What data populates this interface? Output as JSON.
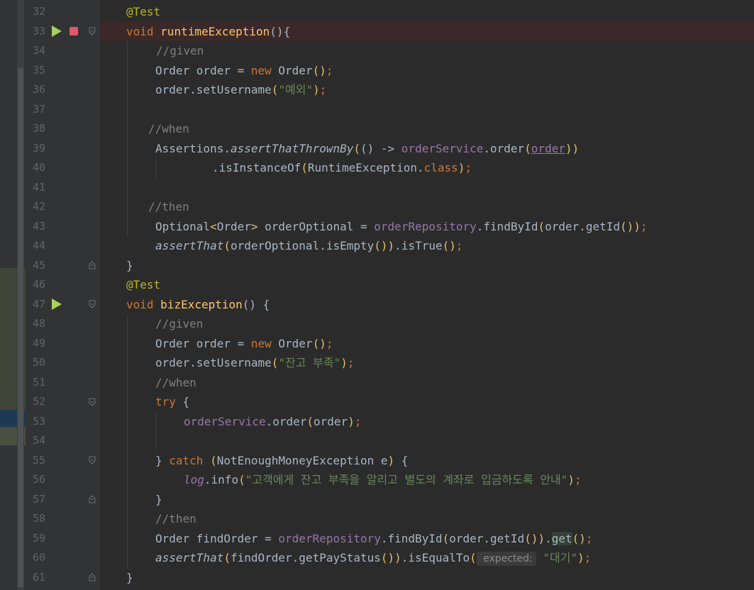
{
  "editor": {
    "lines": [
      {
        "n": "32",
        "tokens": [
          {
            "t": "@Test",
            "c": "an"
          }
        ]
      },
      {
        "n": "33",
        "tokens": [
          {
            "t": "void ",
            "c": "k"
          },
          {
            "t": "runtimeException",
            "c": "fn"
          },
          {
            "t": "(){",
            "c": ""
          }
        ]
      },
      {
        "n": "34",
        "tokens": [
          {
            "t": "//given",
            "c": "cm"
          }
        ]
      },
      {
        "n": "35",
        "tokens": [
          {
            "t": "Order order = ",
            "c": ""
          },
          {
            "t": "new ",
            "c": "k"
          },
          {
            "t": "Order",
            "c": ""
          },
          {
            "t": "()",
            "c": "brk"
          },
          {
            "t": ";",
            "c": "k"
          }
        ]
      },
      {
        "n": "36",
        "tokens": [
          {
            "t": "order.setUsername",
            "c": ""
          },
          {
            "t": "(",
            "c": "brk"
          },
          {
            "t": "\"예외\"",
            "c": "st"
          },
          {
            "t": ")",
            "c": "brk"
          },
          {
            "t": ";",
            "c": "k"
          }
        ]
      },
      {
        "n": "37",
        "tokens": []
      },
      {
        "n": "38",
        "tokens": [
          {
            "t": "//when",
            "c": "cm"
          }
        ]
      },
      {
        "n": "39",
        "tokens": [
          {
            "t": "Assertions.",
            "c": ""
          },
          {
            "t": "assertThatThrownBy",
            "c": "it"
          },
          {
            "t": "(",
            "c": "brk"
          },
          {
            "t": "() -> ",
            "c": ""
          },
          {
            "t": "orderService",
            "c": "fld"
          },
          {
            "t": ".order",
            "c": ""
          },
          {
            "t": "(",
            "c": "brk"
          },
          {
            "t": "order",
            "c": "fld ul"
          },
          {
            "t": "))",
            "c": "brk"
          }
        ]
      },
      {
        "n": "40",
        "tokens": [
          {
            "t": ".isInstanceOf",
            "c": ""
          },
          {
            "t": "(",
            "c": "brk"
          },
          {
            "t": "RuntimeException.",
            "c": ""
          },
          {
            "t": "class",
            "c": "k"
          },
          {
            "t": ")",
            "c": "brk"
          },
          {
            "t": ";",
            "c": "k"
          }
        ]
      },
      {
        "n": "41",
        "tokens": []
      },
      {
        "n": "42",
        "tokens": [
          {
            "t": "//then",
            "c": "cm"
          }
        ]
      },
      {
        "n": "43",
        "tokens": [
          {
            "t": "Optional",
            "c": ""
          },
          {
            "t": "<",
            "c": "brk"
          },
          {
            "t": "Order",
            "c": ""
          },
          {
            "t": ">",
            "c": "brk"
          },
          {
            "t": " orderOptional = ",
            "c": ""
          },
          {
            "t": "orderRepository",
            "c": "fld"
          },
          {
            "t": ".findById",
            "c": ""
          },
          {
            "t": "(",
            "c": "brk"
          },
          {
            "t": "order.getId",
            "c": ""
          },
          {
            "t": "()",
            "c": "brk"
          },
          {
            "t": ")",
            "c": "brk"
          },
          {
            "t": ";",
            "c": "k"
          }
        ]
      },
      {
        "n": "44",
        "tokens": [
          {
            "t": "assertThat",
            "c": "it"
          },
          {
            "t": "(",
            "c": "brk"
          },
          {
            "t": "orderOptional.isEmpty",
            "c": ""
          },
          {
            "t": "()",
            "c": "brk"
          },
          {
            "t": ")",
            "c": "brk"
          },
          {
            "t": ".isTrue",
            "c": ""
          },
          {
            "t": "()",
            "c": "brk"
          },
          {
            "t": ";",
            "c": "k"
          }
        ]
      },
      {
        "n": "45",
        "tokens": [
          {
            "t": "}",
            "c": ""
          }
        ]
      },
      {
        "n": "46",
        "tokens": [
          {
            "t": "@Test",
            "c": "an"
          }
        ]
      },
      {
        "n": "47",
        "tokens": [
          {
            "t": "void ",
            "c": "k"
          },
          {
            "t": "bizException",
            "c": "fn"
          },
          {
            "t": "() {",
            "c": ""
          }
        ]
      },
      {
        "n": "48",
        "tokens": [
          {
            "t": "//given",
            "c": "cm"
          }
        ]
      },
      {
        "n": "49",
        "tokens": [
          {
            "t": "Order order = ",
            "c": ""
          },
          {
            "t": "new ",
            "c": "k"
          },
          {
            "t": "Order",
            "c": ""
          },
          {
            "t": "()",
            "c": "brk"
          },
          {
            "t": ";",
            "c": "k"
          }
        ]
      },
      {
        "n": "50",
        "tokens": [
          {
            "t": "order.setUsername",
            "c": ""
          },
          {
            "t": "(",
            "c": "brk"
          },
          {
            "t": "\"잔고 부족\"",
            "c": "st"
          },
          {
            "t": ")",
            "c": "brk"
          },
          {
            "t": ";",
            "c": "k"
          }
        ]
      },
      {
        "n": "51",
        "tokens": [
          {
            "t": "//when",
            "c": "cm"
          }
        ]
      },
      {
        "n": "52",
        "tokens": [
          {
            "t": "try ",
            "c": "k"
          },
          {
            "t": "{",
            "c": ""
          }
        ]
      },
      {
        "n": "53",
        "tokens": [
          {
            "t": "orderService",
            "c": "fld"
          },
          {
            "t": ".order",
            "c": ""
          },
          {
            "t": "(",
            "c": "brk"
          },
          {
            "t": "order",
            "c": ""
          },
          {
            "t": ")",
            "c": "brk"
          },
          {
            "t": ";",
            "c": "k"
          }
        ]
      },
      {
        "n": "54",
        "tokens": []
      },
      {
        "n": "55",
        "tokens": [
          {
            "t": "} ",
            "c": ""
          },
          {
            "t": "catch ",
            "c": "k"
          },
          {
            "t": "(",
            "c": "brk"
          },
          {
            "t": "NotEnoughMoneyException e",
            "c": ""
          },
          {
            "t": ")",
            "c": "brk"
          },
          {
            "t": " {",
            "c": ""
          }
        ]
      },
      {
        "n": "56",
        "tokens": [
          {
            "t": "log",
            "c": "fld it"
          },
          {
            "t": ".info",
            "c": ""
          },
          {
            "t": "(",
            "c": "brk"
          },
          {
            "t": "\"고객에게 잔고 부족을 알리고 별도의 계좌로 입금하도록 안내\"",
            "c": "st"
          },
          {
            "t": ")",
            "c": "brk"
          },
          {
            "t": ";",
            "c": "k"
          }
        ]
      },
      {
        "n": "57",
        "tokens": [
          {
            "t": "}",
            "c": ""
          }
        ]
      },
      {
        "n": "58",
        "tokens": [
          {
            "t": "//then",
            "c": "cm"
          }
        ]
      },
      {
        "n": "59",
        "tokens": [
          {
            "t": "Order findOrder = ",
            "c": ""
          },
          {
            "t": "orderRepository",
            "c": "fld"
          },
          {
            "t": ".findById",
            "c": ""
          },
          {
            "t": "(",
            "c": "brk"
          },
          {
            "t": "order.getId",
            "c": ""
          },
          {
            "t": "()",
            "c": "brk"
          },
          {
            "t": ")",
            "c": "brk"
          },
          {
            "t": ".",
            "c": ""
          },
          {
            "t": "get",
            "c": "hl"
          },
          {
            "t": "()",
            "c": "brk"
          },
          {
            "t": ";",
            "c": "k"
          }
        ]
      },
      {
        "n": "60",
        "tokens": [
          {
            "t": "assertThat",
            "c": "it"
          },
          {
            "t": "(",
            "c": "brk"
          },
          {
            "t": "findOrder.getPayStatus",
            "c": ""
          },
          {
            "t": "()",
            "c": "brk"
          },
          {
            "t": ")",
            "c": "brk"
          },
          {
            "t": ".isEqualTo",
            "c": ""
          },
          {
            "t": "(",
            "c": "brk"
          },
          {
            "t": " expected:",
            "c": "hint"
          },
          {
            "t": " \"대기\"",
            "c": "st"
          },
          {
            "t": ")",
            "c": "brk"
          },
          {
            "t": ";",
            "c": "k"
          }
        ]
      },
      {
        "n": "61",
        "tokens": [
          {
            "t": "}",
            "c": ""
          }
        ]
      }
    ]
  },
  "gutter": {
    "run_icon": "run-test-icon",
    "breakpoint_icon": "breakpoint-icon",
    "fold_icon": "fold-marker-icon"
  },
  "colors": {
    "background": "#2b2b2b",
    "gutter": "#313335",
    "keyword": "#cc7832",
    "annotation": "#bbb529",
    "method": "#ffc66d",
    "comment": "#808080",
    "string": "#6a8759",
    "field": "#9876aa"
  }
}
